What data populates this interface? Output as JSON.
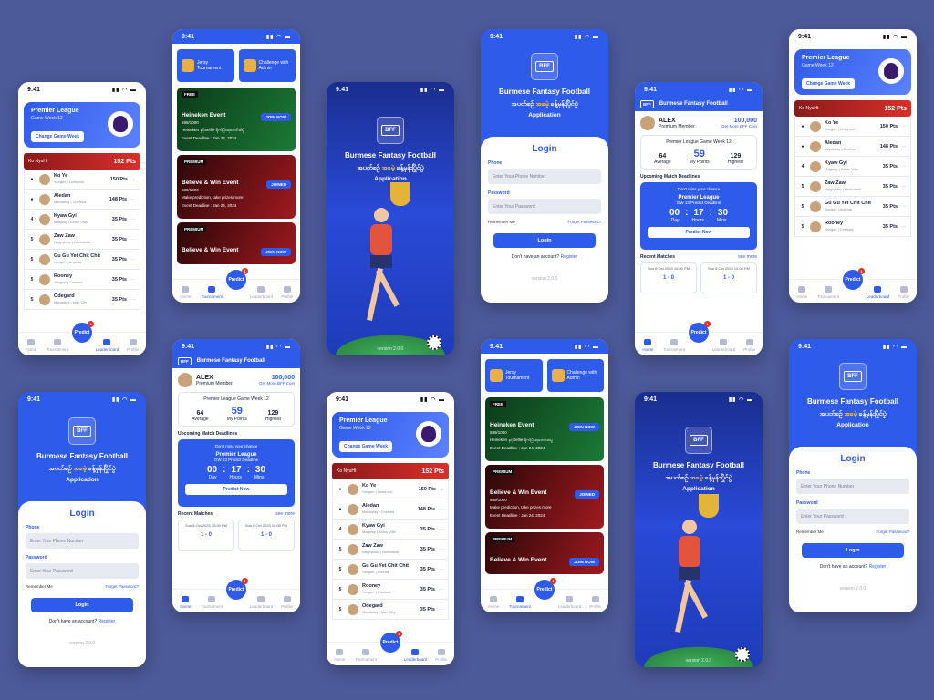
{
  "status_time": "9:41",
  "brand": {
    "app_name": "Burmese Fantasy Football",
    "logo_text": "BFF",
    "tagline_before": "အပတ်စဉ်",
    "tagline_accent": "အခမဲ့",
    "tagline_after": "ခန့်မှန်းပြိုင်ပွဲ",
    "subtitle": "Application",
    "version": "version 2.0.0"
  },
  "league": {
    "title": "Premier League",
    "week": "Game Week 12",
    "change_button": "Change Game Week"
  },
  "leaderboard": {
    "top": {
      "name": "Ko NyuHt",
      "meta": "Yangon | Manchester",
      "points": "152 Pts"
    },
    "rows": [
      {
        "rank": "",
        "name": "Ko Ye",
        "meta": "Yangon | Liverpool",
        "points": "150 Pts"
      },
      {
        "rank": "",
        "name": "Aledan",
        "meta": "Mandalay | Chelsea",
        "points": "148 Pts"
      },
      {
        "rank": "4",
        "name": "Kyaw Gyi",
        "meta": "Magway | Aston Villa",
        "points": "35 Pts"
      },
      {
        "rank": "5",
        "name": "Zaw Zaw",
        "meta": "Naypyitaw | Newcastle",
        "points": "35 Pts"
      },
      {
        "rank": "5",
        "name": "Gu Gu Yet Chit Chit",
        "meta": "Yangon | Arsenal",
        "points": "35 Pts"
      },
      {
        "rank": "5",
        "name": "Rooney",
        "meta": "Yangon | Chelsea",
        "points": "35 Pts"
      },
      {
        "rank": "5",
        "name": "Odegard",
        "meta": "Mandalay | Man City",
        "points": "35 Pts"
      }
    ]
  },
  "nav": {
    "home": "Home",
    "tournament": "Tournament",
    "predict": "Predict",
    "leaderboard": "Leaderboard",
    "profile": "Profile"
  },
  "login": {
    "title": "Login",
    "phone_label": "Phone",
    "phone_placeholder": "Enter Your Phone Number",
    "password_label": "Password",
    "password_placeholder": "Enter Your Password",
    "remember": "Remember Me",
    "forgot": "Forget Password?",
    "button": "Login",
    "no_account": "Don't have an account?",
    "register": "Register"
  },
  "tournament": {
    "tab_jersey": "Jersy Tournament",
    "tab_challenge": "Challenge with Admin",
    "events": [
      {
        "badge": "FREE",
        "title": "Heineken Event",
        "count": "589/1000",
        "desc": "Heineken နှင့်Selfie ရိုက်ပြီးဆုတော်ဆဲပွဲ",
        "deadline": "Event Deadline : Jan 24, 2024",
        "action": "JOIN NOW"
      },
      {
        "badge": "PREMIUM",
        "title": "Believe & Win Event",
        "count": "589/1000",
        "desc": "Make prediction,  take prizes more",
        "deadline": "Event Deadline : Jan 24, 2024",
        "action": "JOINED"
      },
      {
        "badge": "PREMIUM",
        "title": "Believe & Win Event",
        "count": "589/1000",
        "desc": "",
        "deadline": "",
        "action": "JOIN NOW"
      }
    ]
  },
  "home": {
    "user": "ALEX",
    "tier": "Premium Member",
    "coins": "100,000",
    "get_more": "Get More BFF Coin",
    "gw_title": "Premier League Game Week 12",
    "avg_value": "64",
    "avg_label": "Average",
    "my_value": "59",
    "my_label": "My Points",
    "high_value": "129",
    "high_label": "Highest",
    "deadlines_title": "Upcoming Match Deadlines",
    "dont_miss": "Don't miss your chance",
    "gw_predict": "GW 13 Predict Deadline",
    "t_h": "00",
    "t_m": "17",
    "t_s": "30",
    "l_d": "Day",
    "l_h": "Hours",
    "l_m": "Mins",
    "predict_now": "Predict Now",
    "recent_title": "Recent Matches",
    "see_more": "see more",
    "m1_date": "Sun 8 Oct 2023 10:00 PM",
    "m1_score": "1 - 0",
    "m2_date": "Sun 8 Oct 2023 10:00 PM",
    "m2_score": "1 - 0"
  }
}
